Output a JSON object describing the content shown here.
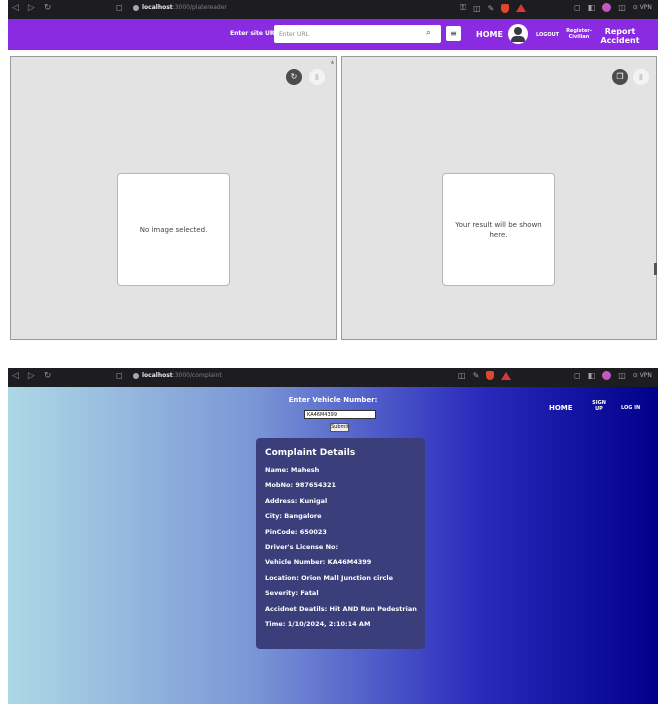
{
  "shot1": {
    "browser": {
      "host": "localhost",
      "path": ":3000/platereader",
      "vpn_label": "VPN"
    },
    "navbar": {
      "site_url_label": "Enter site URL:",
      "site_url_placeholder": "Enter URL",
      "home": "HOME",
      "logout": "LOGOUT",
      "register_line1": "Register-",
      "register_line2": "Civilian",
      "report_line1": "Report",
      "report_line2": "Accident"
    },
    "left_panel": {
      "message": "No image selected."
    },
    "right_panel": {
      "message": "Your result will be shown here."
    },
    "icons": [
      "undo-icon",
      "delete-icon",
      "copy-icon",
      "delete-icon"
    ]
  },
  "shot2": {
    "browser": {
      "host": "localhost",
      "path": ":3000/complaint",
      "vpn_label": "VPN"
    },
    "form": {
      "label": "Enter Vehicle Number:",
      "value": "KA46M4399",
      "submit": "Submit"
    },
    "navbar": {
      "home": "HOME",
      "signup_line1": "SIGN",
      "signup_line2": "UP",
      "login": "LOG IN"
    },
    "complaint": {
      "title": "Complaint Details",
      "lines": [
        "Name: Mahesh",
        "MobNo: 987654321",
        "Address: Kunigal",
        "City: Bangalore",
        "PinCode: 650023",
        "Driver's License No:",
        "Vehicle Number: KA46M4399",
        "Location: Orion Mall Junction circle",
        "Severity: Fatal",
        "Accidnet Deatils: Hit AND Run Pedestrian",
        "Time: 1/10/2024, 2:10:14 AM"
      ]
    }
  },
  "colors": {
    "navbar_purple": "#8a2be2",
    "panel_gray": "#e3e3e3",
    "gradient_start": "#add8e6",
    "gradient_end": "#00008b",
    "card_bg": "#3a3e7a"
  }
}
